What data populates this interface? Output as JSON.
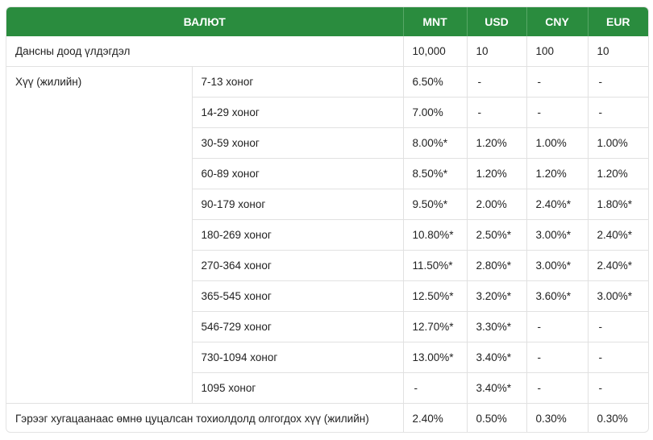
{
  "headers": [
    "ВАЛЮТ",
    "MNT",
    "USD",
    "CNY",
    "EUR"
  ],
  "min_balance": {
    "label": "Дансны доод үлдэгдэл",
    "values": [
      "10,000",
      "10",
      "100",
      "10"
    ]
  },
  "rate_label": "Хүү (жилийн)",
  "terms": [
    {
      "term": "7-13 хоног",
      "values": [
        "6.50%",
        "-",
        "-",
        "-"
      ]
    },
    {
      "term": "14-29 хоног",
      "values": [
        "7.00%",
        "-",
        "-",
        "-"
      ]
    },
    {
      "term": "30-59 хоног",
      "values": [
        "8.00%*",
        "1.20%",
        "1.00%",
        "1.00%"
      ]
    },
    {
      "term": "60-89 хоног",
      "values": [
        "8.50%*",
        "1.20%",
        "1.20%",
        "1.20%"
      ]
    },
    {
      "term": "90-179 хоног",
      "values": [
        "9.50%*",
        "2.00%",
        "2.40%*",
        "1.80%*"
      ]
    },
    {
      "term": "180-269 хоног",
      "values": [
        "10.80%*",
        "2.50%*",
        "3.00%*",
        "2.40%*"
      ]
    },
    {
      "term": "270-364 хоног",
      "values": [
        "11.50%*",
        "2.80%*",
        "3.00%*",
        "2.40%*"
      ]
    },
    {
      "term": "365-545 хоног",
      "values": [
        "12.50%*",
        "3.20%*",
        "3.60%*",
        "3.00%*"
      ]
    },
    {
      "term": "546-729 хоног",
      "values": [
        "12.70%*",
        "3.30%*",
        "-",
        "-"
      ]
    },
    {
      "term": "730-1094 хоног",
      "values": [
        "13.00%*",
        "3.40%*",
        "-",
        "-"
      ]
    },
    {
      "term": "1095 хоног",
      "values": [
        "-",
        "3.40%*",
        "-",
        "-"
      ]
    }
  ],
  "early": {
    "label": "Гэрээг хугацаанаас өмнө цуцалсан тохиолдолд олгогдох хүү (жилийн)",
    "values": [
      "2.40%",
      "0.50%",
      "0.30%",
      "0.30%"
    ]
  }
}
